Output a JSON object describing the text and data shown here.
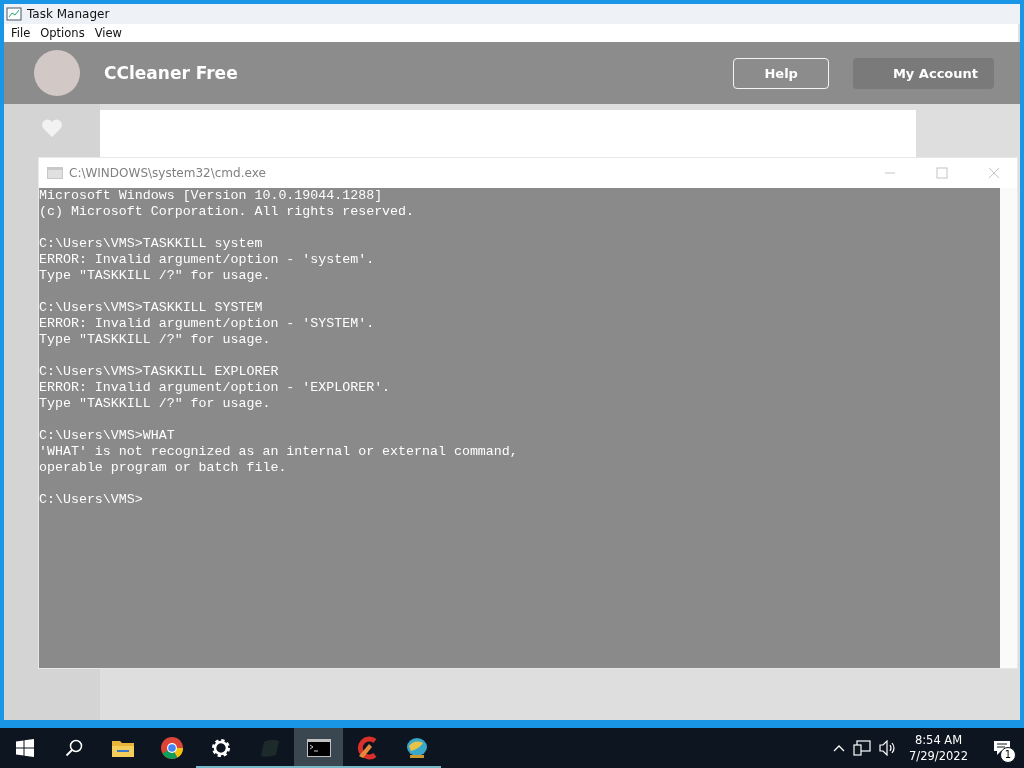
{
  "task_manager": {
    "title": "Task Manager",
    "menu": [
      "File",
      "Options",
      "View"
    ]
  },
  "background_app": {
    "title": "CCleaner Free",
    "buttons": [
      "Help",
      "My Account"
    ]
  },
  "console": {
    "title": "C:\\WINDOWS\\system32\\cmd.exe",
    "blocks": [
      [
        "Microsoft Windows [Version 10.0.19044.1288]",
        "(c) Microsoft Corporation. All rights reserved."
      ],
      [
        "C:\\Users\\VMS>TASKKILL system",
        "ERROR: Invalid argument/option - 'system'.",
        "Type \"TASKKILL /?\" for usage."
      ],
      [
        "C:\\Users\\VMS>TASKKILL SYSTEM",
        "ERROR: Invalid argument/option - 'SYSTEM'.",
        "Type \"TASKKILL /?\" for usage."
      ],
      [
        "C:\\Users\\VMS>TASKKILL EXPLORER",
        "ERROR: Invalid argument/option - 'EXPLORER'.",
        "Type \"TASKKILL /?\" for usage."
      ],
      [
        "C:\\Users\\VMS>WHAT",
        "'WHAT' is not recognized as an internal or external command,",
        "operable program or batch file."
      ],
      [
        "C:\\Users\\VMS>"
      ]
    ]
  },
  "taskbar": {
    "apps": [
      {
        "kind": "folder",
        "running": false,
        "selected": false
      },
      {
        "kind": "chrome",
        "running": false,
        "selected": false
      },
      {
        "kind": "gear",
        "running": true,
        "selected": false
      },
      {
        "kind": "blob",
        "running": true,
        "selected": false
      },
      {
        "kind": "terminal",
        "running": true,
        "selected": true
      },
      {
        "kind": "cleaner",
        "running": true,
        "selected": false
      },
      {
        "kind": "globe",
        "running": true,
        "selected": false
      }
    ],
    "time": "8:54 AM",
    "date": "7/29/2022",
    "notification_count": "1"
  }
}
